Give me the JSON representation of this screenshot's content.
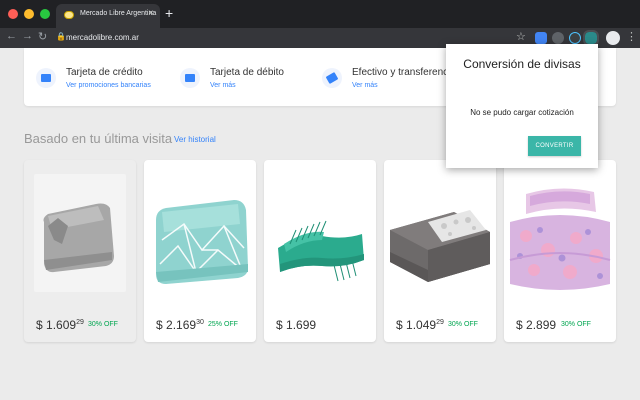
{
  "browser": {
    "tab_title": "Mercado Libre Argentina",
    "tab_close": "×",
    "new_tab": "+",
    "url": "mercadolibre.com.ar",
    "nav": {
      "back": "←",
      "forward": "→",
      "reload": "↻"
    },
    "lock": "🔒",
    "star": "☆",
    "menu": "⋮"
  },
  "payments": [
    {
      "title": "Tarjeta de crédito",
      "link": "Ver promociones bancarias",
      "icon": "credit-card-icon"
    },
    {
      "title": "Tarjeta de débito",
      "link": "Ver más",
      "icon": "debit-card-icon"
    },
    {
      "title": "Efectivo y transferencia",
      "link": "Ver más",
      "icon": "cash-icon"
    }
  ],
  "section": {
    "title": "Basado en tu última visita",
    "history_link": "Ver historial"
  },
  "products": [
    {
      "currency": "$",
      "price": "1.609",
      "cents": "29",
      "discount": "30% OFF"
    },
    {
      "currency": "$",
      "price": "2.169",
      "cents": "30",
      "discount": "25% OFF"
    },
    {
      "currency": "$",
      "price": "1.699",
      "cents": "",
      "discount": ""
    },
    {
      "currency": "$",
      "price": "1.049",
      "cents": "29",
      "discount": "30% OFF"
    },
    {
      "currency": "$",
      "price": "2.899",
      "cents": "",
      "discount": "30% OFF"
    }
  ],
  "popup": {
    "title": "Conversión de divisas",
    "message": "No se pudo cargar cotización",
    "button": "CONVERTIR"
  },
  "colors": {
    "accent": "#3483fa",
    "discount": "#00a650",
    "popup_button": "#3bb6a8"
  }
}
